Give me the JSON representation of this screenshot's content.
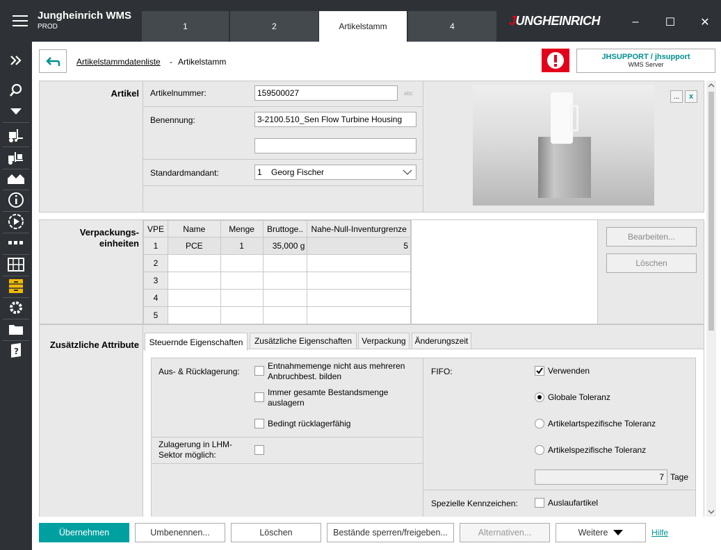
{
  "app": {
    "title": "Jungheinrich WMS",
    "env": "PROD",
    "logo": "JUNGHEINRICH"
  },
  "tabs": [
    {
      "label": "1"
    },
    {
      "label": "2"
    },
    {
      "label": "Artikelstamm"
    },
    {
      "label": "4"
    }
  ],
  "window": {
    "minimize": "–",
    "maximize": "☐",
    "close": "✕"
  },
  "breadcrumb": {
    "parent": "Artikelstammdatenliste",
    "sep": "-",
    "current": "Artikelstamm"
  },
  "user": {
    "name": "JHSUPPORT / jhsupport",
    "server": "WMS Server"
  },
  "artikel": {
    "section": "Artikel",
    "nr_label": "Artikelnummer:",
    "nr_value": "159500027",
    "nr_hint": "abc",
    "benennung_label": "Benennung:",
    "benennung_value": "3-2100.510_Sen Flow Turbine Housing",
    "benennung2_value": "",
    "mandant_label": "Standardmandant:",
    "mandant_value": "1    Georg Fischer",
    "img_btn1": "...",
    "img_btn2": "x"
  },
  "vpe": {
    "section": "Verpackungs-\neinheiten",
    "columns": [
      "VPE",
      "Name",
      "Menge",
      "Bruttoge..",
      "Nahe-Null-Inventurgrenze"
    ],
    "rows": [
      [
        "1",
        "PCE",
        "1",
        "35,000 g",
        "5"
      ],
      [
        "2",
        "",
        "",
        "",
        ""
      ],
      [
        "3",
        "",
        "",
        "",
        ""
      ],
      [
        "4",
        "",
        "",
        "",
        ""
      ],
      [
        "5",
        "",
        "",
        "",
        ""
      ]
    ],
    "edit": "Bearbeiten...",
    "delete": "Löschen"
  },
  "attrs": {
    "section": "Zusätzliche Attribute",
    "tabs": [
      "Steuernde Eigenschaften",
      "Zusätzliche Eigenschaften",
      "Verpackung",
      "Änderungszeit"
    ],
    "aus_label": "Aus- & Rücklagerung:",
    "cb1": "Entnahmemenge nicht aus mehreren Anbruchbest. bilden",
    "cb2": "Immer gesamte Bestandsmenge auslagern",
    "cb3": "Bedingt rücklagerfähig",
    "zul_label": "Zulagerung in LHM-Sektor möglich:",
    "fifo_label": "FIFO:",
    "fifo_use": "Verwenden",
    "r1": "Globale Toleranz",
    "r2": "Artikelartspezifische Toleranz",
    "r3": "Artikelspezifische Toleranz",
    "tage_value": "7",
    "tage_label": "Tage",
    "spez_label": "Spezielle Kennzeichen:",
    "auslauf": "Auslaufartikel"
  },
  "footer": {
    "ok": "Übernehmen",
    "rename": "Umbenennen...",
    "delete": "Löschen",
    "lock": "Bestände sperren/freigeben...",
    "alt": "Alternativen...",
    "more": "Weitere",
    "help": "Hilfe"
  }
}
